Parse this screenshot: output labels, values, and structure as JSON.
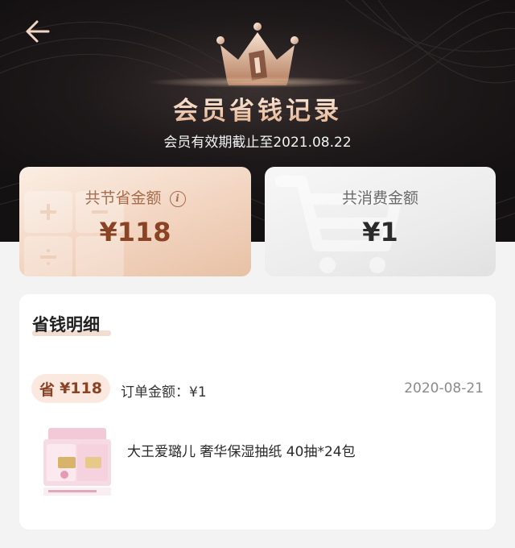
{
  "header": {
    "back_icon": "back-arrow-icon",
    "crown_icon": "crown-badge-icon",
    "title": "会员省钱记录",
    "expiry": "会员有效期截止至2021.08.22"
  },
  "summary": {
    "saved_label": "共节省金额",
    "saved_info_icon": "info-icon",
    "saved_info_glyph": "i",
    "saved_value": "¥118",
    "spent_label": "共消费金额",
    "spent_value": "¥1"
  },
  "details": {
    "title": "省钱明细",
    "orders": [
      {
        "save_prefix": "省",
        "save_amount": "¥118",
        "order_amount": "订单金额：¥1",
        "date": "2020-08-21",
        "product_name": "大王爱璐儿 奢华保湿抽纸 40抽*24包",
        "product_icon": "tissue-pack-image"
      }
    ]
  },
  "colors": {
    "accent_brown": "#8a4425",
    "hero_dark": "#1d1819",
    "gold": "#e2b08d"
  }
}
